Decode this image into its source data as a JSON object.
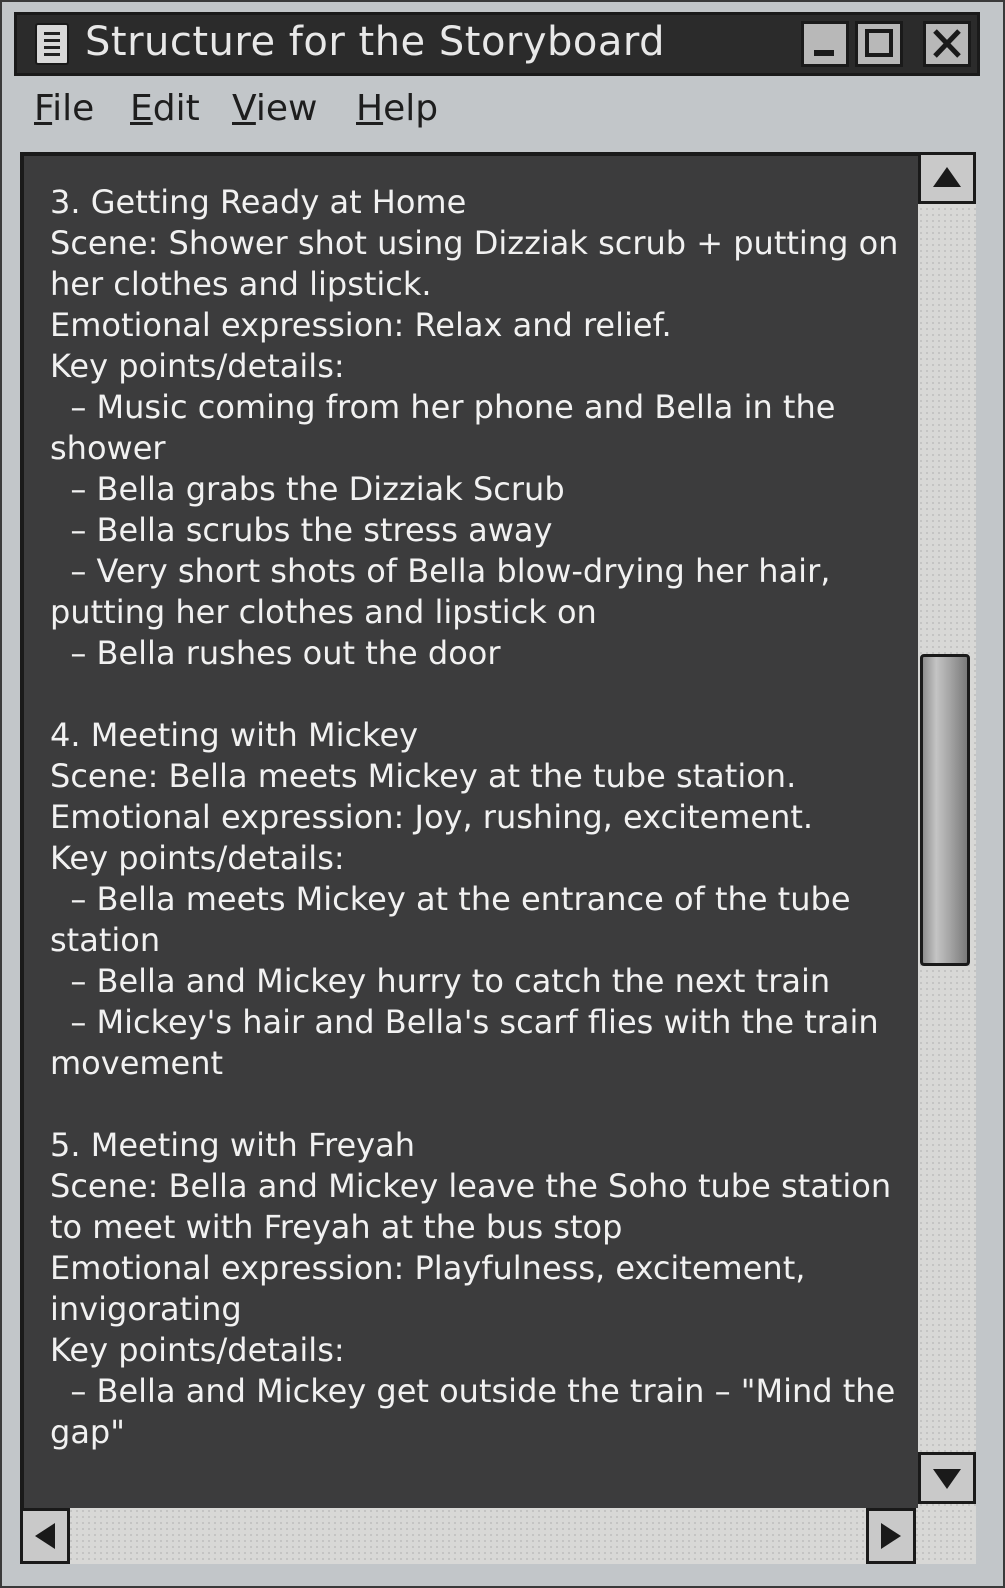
{
  "window": {
    "title": "Structure for the Storyboard",
    "icon": "document-icon",
    "controls": [
      "minimize-icon",
      "maximize-icon",
      "close-icon"
    ]
  },
  "menu": {
    "file": {
      "first": "F",
      "rest": "ile"
    },
    "edit": {
      "first": "E",
      "rest": "dit"
    },
    "view": {
      "first": "V",
      "rest": "iew"
    },
    "help": {
      "first": "H",
      "rest": "elp"
    }
  },
  "document": {
    "text": "3. Getting Ready at Home\nScene: Shower shot using Dizziak scrub + putting on her clothes and lipstick.\nEmotional expression: Relax and relief.\nKey points/details:\n  – Music coming from her phone and Bella in the shower\n  – Bella grabs the Dizziak Scrub\n  – Bella scrubs the stress away\n  – Very short shots of Bella blow-drying her hair, putting her clothes and lipstick on\n  – Bella rushes out the door\n\n4. Meeting with Mickey\nScene: Bella meets Mickey at the tube station.\nEmotional expression: Joy, rushing, excitement.\nKey points/details:\n  – Bella meets Mickey at the entrance of the tube station\n  – Bella and Mickey hurry to catch the next train\n  – Mickey's hair and Bella's scarf flies with the train movement\n\n5. Meeting with Freyah\nScene: Bella and Mickey leave the Soho tube station to meet with Freyah at the bus stop\nEmotional expression: Playfulness, excitement, invigorating\nKey points/details:\n  – Bella and Mickey get outside the train – \"Mind the gap\""
  },
  "colors": {
    "titlebar": "#2b2b2b",
    "document_bg": "#3c3c3d",
    "document_text": "#f1f1f1",
    "chrome": "#c2c6c9"
  }
}
